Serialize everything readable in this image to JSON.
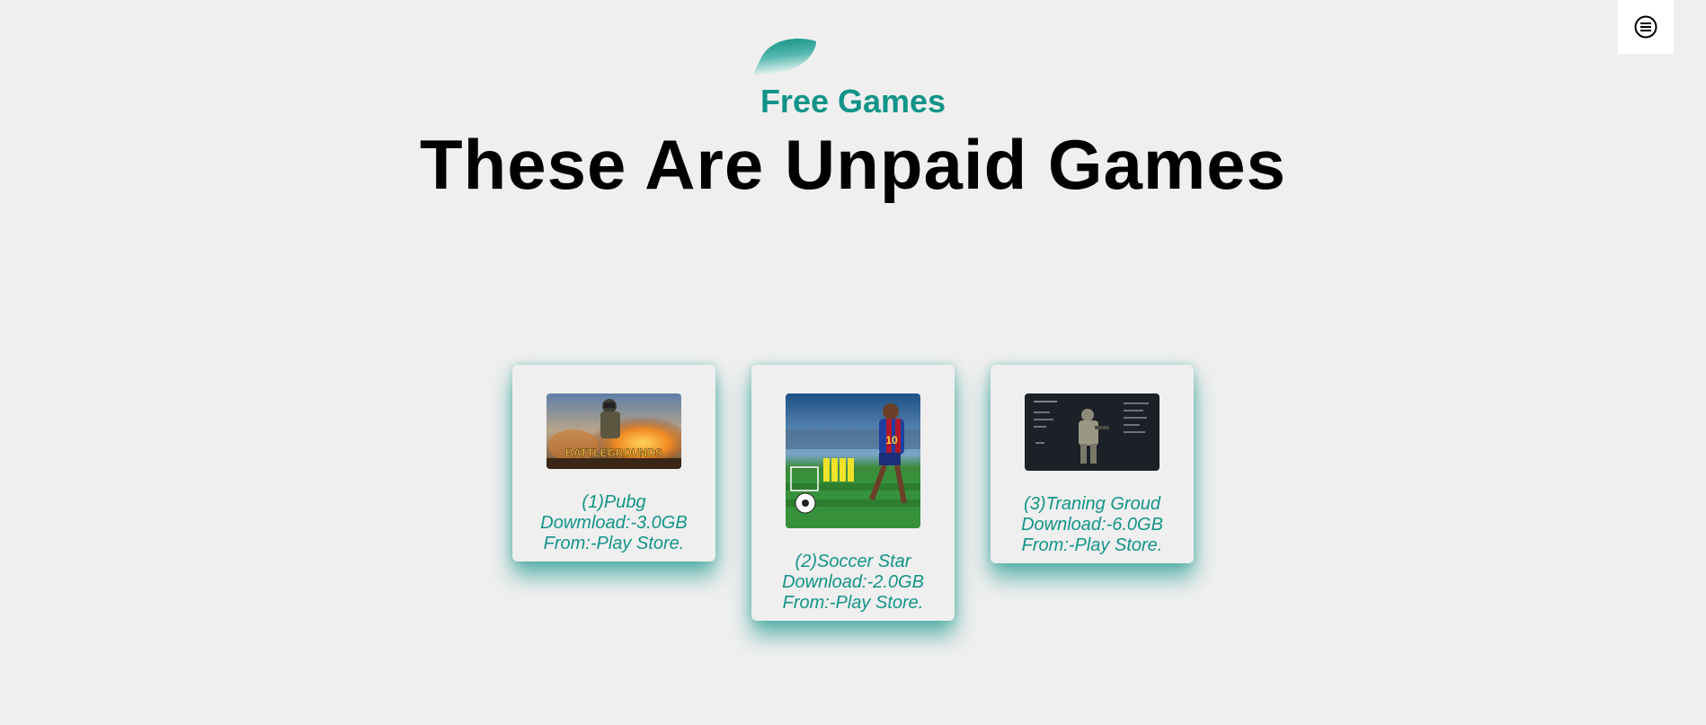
{
  "header": {
    "subtitle": "Free Games",
    "title": "These Are Unpaid Games",
    "menu_icon": "menu-lines-icon",
    "leaf_icon": "leaf-icon"
  },
  "colors": {
    "accent": "#129488",
    "background": "#efefef",
    "title": "#000000"
  },
  "games": [
    {
      "name_line": "(1)Pubg",
      "download_line": "Dowmload:-3.0GB",
      "source_line": "From:-Play Store.",
      "image": "pubg-battlegrounds-image",
      "image_text": "BATTLEGROUNDS"
    },
    {
      "name_line": "(2)Soccer Star",
      "download_line": "Download:-2.0GB",
      "source_line": "From:-Play Store.",
      "image": "soccer-star-image",
      "image_text": "10"
    },
    {
      "name_line": "(3)Traning Groud",
      "download_line": "Download:-6.0GB",
      "source_line": "From:-Play Store.",
      "image": "training-ground-image"
    }
  ]
}
